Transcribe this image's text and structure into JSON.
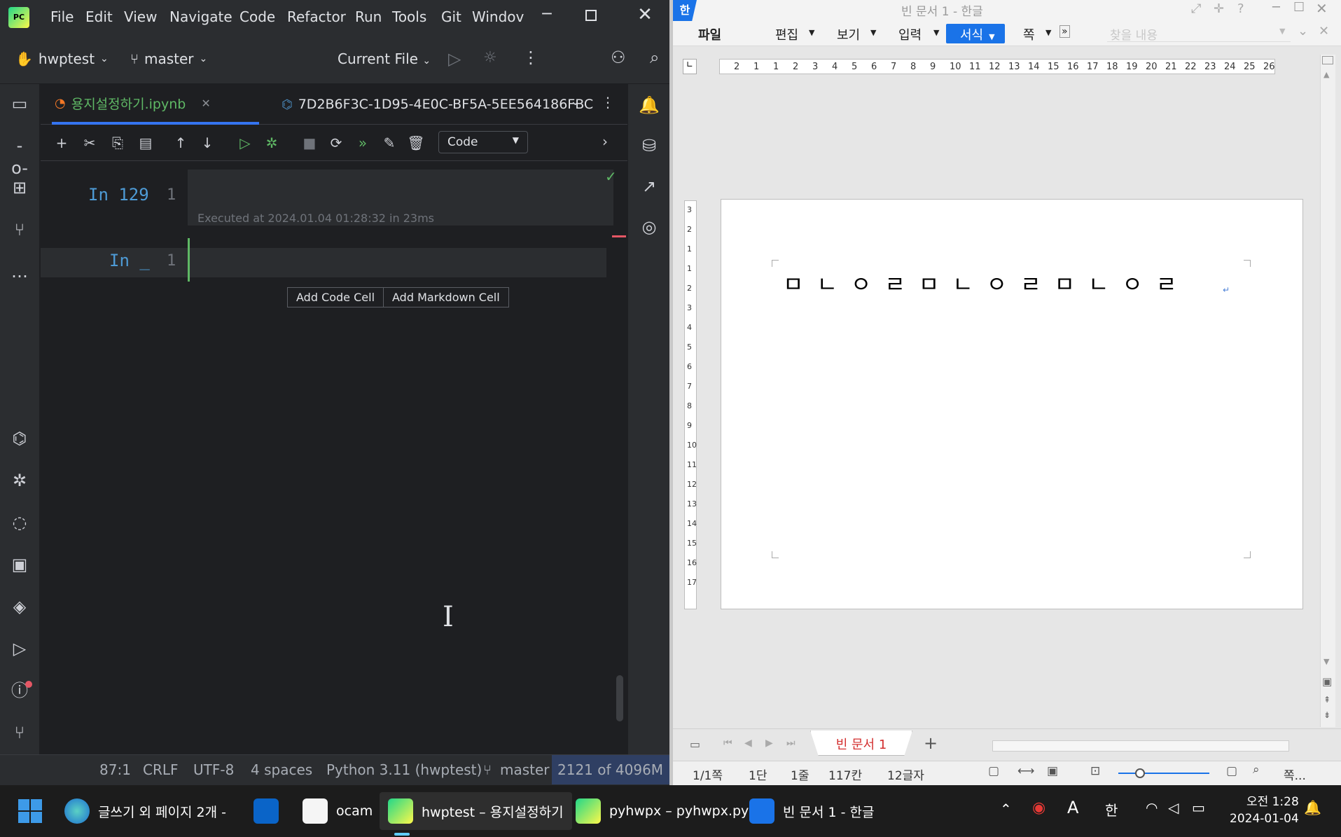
{
  "ide": {
    "menu": [
      "File",
      "Edit",
      "View",
      "Navigate",
      "Code",
      "Refactor",
      "Run",
      "Tools",
      "Git",
      "Windov"
    ],
    "project": "hwptest",
    "branch": "master",
    "run_config": "Current File",
    "tabs": [
      {
        "label": "용지설정하기.ipynb"
      },
      {
        "label": "7D2B6F3C-1D95-4E0C-BF5A-5EE564186FBC"
      }
    ],
    "cell_type": "Code",
    "cells": [
      {
        "prompt": "In 129",
        "line": "1",
        "exec": "Executed at 2024.01.04 01:28:32 in 23ms"
      },
      {
        "prompt": "In _",
        "line": "1"
      }
    ],
    "add_code": "Add Code Cell",
    "add_md": "Add Markdown Cell",
    "status": {
      "pos": "87:1",
      "eol": "CRLF",
      "enc": "UTF-8",
      "indent": "4 spaces",
      "interp": "Python 3.11 (hwptest)",
      "branch": "master",
      "mem": "2121 of 4096M"
    }
  },
  "hwp": {
    "title": "빈 문서 1 - 한글",
    "menus": [
      "파일",
      "편집",
      "보기",
      "입력",
      "서식",
      "쪽"
    ],
    "search_placeholder": "찾을 내용",
    "doc_text": "ㅁㄴㅇㄹㅁㄴㅇㄹㅁㄴㅇㄹ",
    "doc_tab": "빈 문서 1",
    "status": {
      "page": "1/1쪽",
      "col": "1단",
      "line": "1줄",
      "pos": "117칸",
      "chars": "12글자",
      "zoom": "쪽..."
    },
    "ruler_h": [
      "2",
      "1",
      "1",
      "2",
      "3",
      "4",
      "5",
      "6",
      "7",
      "8",
      "9",
      "10",
      "11",
      "12",
      "13",
      "14",
      "15",
      "16",
      "17",
      "18",
      "19",
      "20",
      "21",
      "22",
      "23",
      "24",
      "25",
      "26"
    ],
    "ruler_v": [
      "3",
      "2",
      "1",
      "1",
      "2",
      "3",
      "4",
      "5",
      "6",
      "7",
      "8",
      "9",
      "10",
      "11",
      "12",
      "13",
      "14",
      "15",
      "16",
      "17"
    ]
  },
  "taskbar": {
    "apps": [
      "글쓰기 외 페이지 2개 -",
      "ocam",
      "hwptest – 용지설정하기",
      "pyhwpx – pyhwpx.py",
      "빈 문서 1 - 한글"
    ],
    "time": "오전 1:28",
    "date": "2024-01-04",
    "colors": {
      "accent": "#3574f0",
      "hwp_active": "#1a73e8"
    }
  }
}
